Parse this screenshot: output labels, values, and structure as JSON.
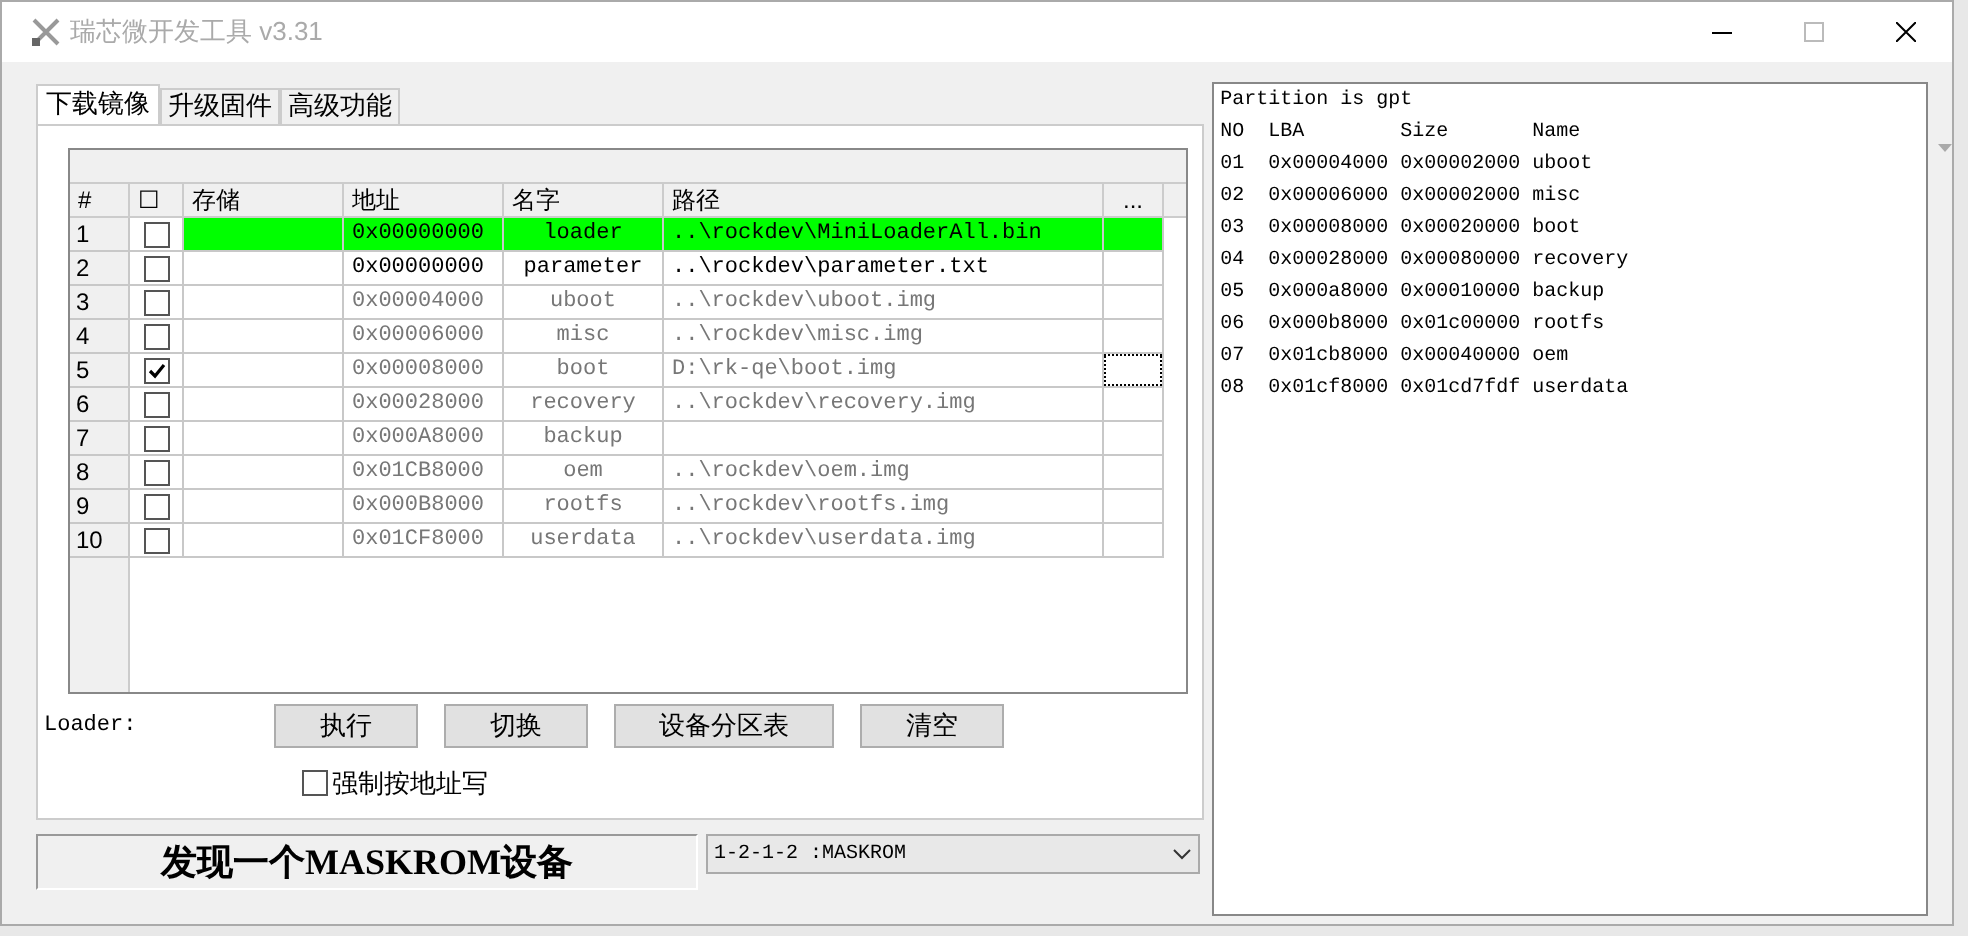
{
  "window": {
    "title": "瑞芯微开发工具 v3.31"
  },
  "tabs": [
    {
      "label": "下载镜像",
      "selected": true
    },
    {
      "label": "升级固件",
      "selected": false
    },
    {
      "label": "高级功能",
      "selected": false
    }
  ],
  "table": {
    "columns": [
      "#",
      "☐",
      "存储",
      "地址",
      "名字",
      "路径",
      "..."
    ],
    "rows": [
      {
        "index": "1",
        "checked": false,
        "selected": true,
        "active": true,
        "address": "0x00000000",
        "name": "loader",
        "path": "..\\rockdev\\MiniLoaderAll.bin",
        "focused": false
      },
      {
        "index": "2",
        "checked": false,
        "selected": false,
        "active": true,
        "address": "0x00000000",
        "name": "parameter",
        "path": "..\\rockdev\\parameter.txt",
        "focused": false
      },
      {
        "index": "3",
        "checked": false,
        "selected": false,
        "active": false,
        "address": "0x00004000",
        "name": "uboot",
        "path": "..\\rockdev\\uboot.img",
        "focused": false
      },
      {
        "index": "4",
        "checked": false,
        "selected": false,
        "active": false,
        "address": "0x00006000",
        "name": "misc",
        "path": "..\\rockdev\\misc.img",
        "focused": false
      },
      {
        "index": "5",
        "checked": true,
        "selected": false,
        "active": false,
        "address": "0x00008000",
        "name": "boot",
        "path": "D:\\rk-qe\\boot.img",
        "focused": true
      },
      {
        "index": "6",
        "checked": false,
        "selected": false,
        "active": false,
        "address": "0x00028000",
        "name": "recovery",
        "path": "..\\rockdev\\recovery.img",
        "focused": false
      },
      {
        "index": "7",
        "checked": false,
        "selected": false,
        "active": false,
        "address": "0x000A8000",
        "name": "backup",
        "path": "",
        "focused": false
      },
      {
        "index": "8",
        "checked": false,
        "selected": false,
        "active": false,
        "address": "0x01CB8000",
        "name": "oem",
        "path": "..\\rockdev\\oem.img",
        "focused": false
      },
      {
        "index": "9",
        "checked": false,
        "selected": false,
        "active": false,
        "address": "0x000B8000",
        "name": "rootfs",
        "path": "..\\rockdev\\rootfs.img",
        "focused": false
      },
      {
        "index": "10",
        "checked": false,
        "selected": false,
        "active": false,
        "address": "0x01CF8000",
        "name": "userdata",
        "path": "..\\rockdev\\userdata.img",
        "focused": false
      }
    ]
  },
  "loader_label": "Loader:",
  "buttons": [
    "执行",
    "切换",
    "设备分区表",
    "清空"
  ],
  "force_write": {
    "label": "强制按地址写",
    "checked": false
  },
  "status": "发现一个MASKROM设备",
  "device_select": {
    "value": "1-2-1-2 :MASKROM"
  },
  "log": [
    "Partition is gpt",
    "NO  LBA        Size       Name",
    "01  0x00004000 0x00002000 uboot",
    "02  0x00006000 0x00002000 misc",
    "03  0x00008000 0x00020000 boot",
    "04  0x00028000 0x00080000 recovery",
    "05  0x000a8000 0x00010000 backup",
    "06  0x000b8000 0x01c00000 rootfs",
    "07  0x01cb8000 0x00040000 oem",
    "08  0x01cf8000 0x01cd7fdf userdata"
  ]
}
